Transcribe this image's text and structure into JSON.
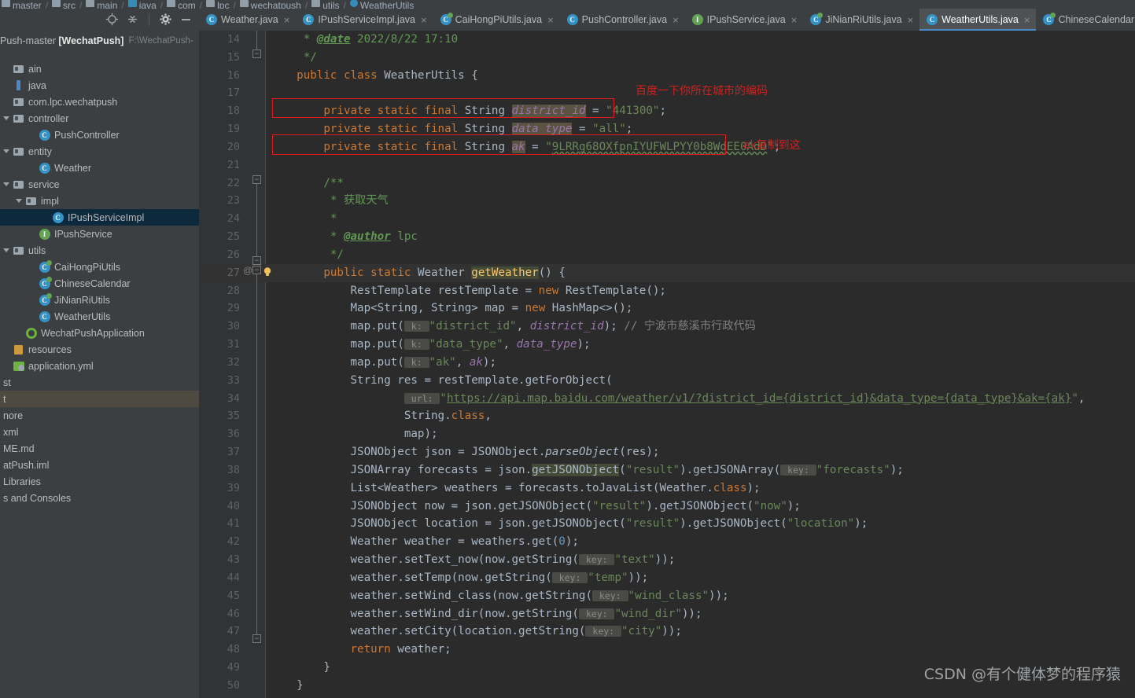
{
  "window": {
    "project_label_left": "Push-master",
    "project_name": "[WechatPush]",
    "project_path": "F:\\WechatPush-"
  },
  "breadcrumb": {
    "items": [
      "master",
      "src",
      "main",
      "java",
      "com",
      "lpc",
      "wechatpush",
      "utils",
      "WeatherUtils"
    ]
  },
  "sidebar": {
    "toolbar_icons": [
      "locate-icon",
      "collapse-all-icon",
      "gear-icon",
      "minimize-icon"
    ],
    "tree": [
      {
        "label": "ain",
        "icon": "folder-icon",
        "indent": 0,
        "arrow": "none",
        "selected": "none"
      },
      {
        "label": "java",
        "icon": "source-root-icon",
        "indent": 0,
        "arrow": "none",
        "selected": "none"
      },
      {
        "label": "com.lpc.wechatpush",
        "icon": "package-icon",
        "indent": 1,
        "arrow": "none",
        "selected": "none"
      },
      {
        "label": "controller",
        "icon": "package-icon",
        "indent": 1,
        "arrow": "open",
        "selected": "none"
      },
      {
        "label": "PushController",
        "icon": "class-icon",
        "indent": 3,
        "arrow": "none",
        "selected": "none"
      },
      {
        "label": "entity",
        "icon": "package-icon",
        "indent": 1,
        "arrow": "open",
        "selected": "none"
      },
      {
        "label": "Weather",
        "icon": "class-icon",
        "indent": 3,
        "arrow": "none",
        "selected": "none"
      },
      {
        "label": "service",
        "icon": "package-icon",
        "indent": 1,
        "arrow": "open",
        "selected": "none"
      },
      {
        "label": "impl",
        "icon": "package-icon",
        "indent": 2,
        "arrow": "open",
        "selected": "none"
      },
      {
        "label": "IPushServiceImpl",
        "icon": "class-icon",
        "indent": 4,
        "arrow": "none",
        "selected": "blue"
      },
      {
        "label": "IPushService",
        "icon": "interface-icon",
        "indent": 3,
        "arrow": "none",
        "selected": "none"
      },
      {
        "label": "utils",
        "icon": "package-icon",
        "indent": 1,
        "arrow": "open",
        "selected": "none"
      },
      {
        "label": "CaiHongPiUtils",
        "icon": "class-green-icon",
        "indent": 3,
        "arrow": "none",
        "selected": "none"
      },
      {
        "label": "ChineseCalendar",
        "icon": "class-green-icon",
        "indent": 3,
        "arrow": "none",
        "selected": "none"
      },
      {
        "label": "JiNianRiUtils",
        "icon": "class-green-icon",
        "indent": 3,
        "arrow": "none",
        "selected": "none"
      },
      {
        "label": "WeatherUtils",
        "icon": "class-icon",
        "indent": 3,
        "arrow": "none",
        "selected": "none"
      },
      {
        "label": "WechatPushApplication",
        "icon": "spring-boot-icon",
        "indent": 2,
        "arrow": "none",
        "selected": "none"
      },
      {
        "label": "resources",
        "icon": "resource-root-icon",
        "indent": 0,
        "arrow": "none",
        "selected": "none"
      },
      {
        "label": "application.yml",
        "icon": "yml-icon",
        "indent": 1,
        "arrow": "none",
        "selected": "none"
      },
      {
        "label": "st",
        "icon": "none",
        "indent": 0,
        "arrow": "none",
        "selected": "none"
      },
      {
        "label": "t",
        "icon": "none",
        "indent": 0,
        "arrow": "none",
        "selected": "grey"
      },
      {
        "label": "nore",
        "icon": "none",
        "indent": 0,
        "arrow": "none",
        "selected": "none"
      },
      {
        "label": "xml",
        "icon": "none",
        "indent": 0,
        "arrow": "none",
        "selected": "none"
      },
      {
        "label": "ME.md",
        "icon": "none",
        "indent": 0,
        "arrow": "none",
        "selected": "none"
      },
      {
        "label": "atPush.iml",
        "icon": "none",
        "indent": 0,
        "arrow": "none",
        "selected": "none"
      },
      {
        "label": "Libraries",
        "icon": "none",
        "indent": 0,
        "arrow": "none",
        "selected": "none"
      },
      {
        "label": "s and Consoles",
        "icon": "none",
        "indent": 0,
        "arrow": "none",
        "selected": "none"
      }
    ]
  },
  "tabs": [
    {
      "label": "Weather.java",
      "icon": "class-icon",
      "active": false,
      "closable": true
    },
    {
      "label": "IPushServiceImpl.java",
      "icon": "class-icon",
      "active": false,
      "closable": true
    },
    {
      "label": "CaiHongPiUtils.java",
      "icon": "class-green-icon",
      "active": false,
      "closable": true
    },
    {
      "label": "PushController.java",
      "icon": "class-icon",
      "active": false,
      "closable": true
    },
    {
      "label": "IPushService.java",
      "icon": "interface-icon",
      "active": false,
      "closable": true
    },
    {
      "label": "JiNianRiUtils.java",
      "icon": "class-green-icon",
      "active": false,
      "closable": true
    },
    {
      "label": "WeatherUtils.java",
      "icon": "class-icon",
      "active": true,
      "closable": true
    },
    {
      "label": "ChineseCalendar",
      "icon": "class-green-icon",
      "active": false,
      "closable": false
    }
  ],
  "editor": {
    "first_line_number": 14,
    "last_line_number": 50,
    "line_numbers": [
      14,
      15,
      16,
      17,
      18,
      19,
      20,
      21,
      22,
      23,
      24,
      25,
      26,
      27,
      28,
      29,
      30,
      31,
      32,
      33,
      34,
      35,
      36,
      37,
      38,
      39,
      40,
      41,
      42,
      43,
      44,
      45,
      46,
      47,
      48,
      49,
      50
    ],
    "code_lines": [
      "     * @date 2022/8/22 17:10",
      "     */",
      "    public class WeatherUtils {",
      "",
      "        private static final String district_id = \"441300\";",
      "        private static final String data_type = \"all\";",
      "        private static final String ak = \"9LRRg68OXfpnIYUFWLPYY0b8WdEE0AdD\";",
      "",
      "        /**",
      "         * 获取天气",
      "         *",
      "         * @author lpc",
      "         */",
      "        public static Weather getWeather() {",
      "            RestTemplate restTemplate = new RestTemplate();",
      "            Map<String, String> map = new HashMap<>();",
      "            map.put( k: \"district_id\", district_id); // 宁波市慈溪市行政代码",
      "            map.put( k: \"data_type\", data_type);",
      "            map.put( k: \"ak\", ak);",
      "            String res = restTemplate.getForObject(",
      "                    url: \"https://api.map.baidu.com/weather/v1/?district_id={district_id}&data_type={data_type}&ak={ak}\",",
      "                    String.class,",
      "                    map);",
      "            JSONObject json = JSONObject.parseObject(res);",
      "            JSONArray forecasts = json.getJSONObject(\"result\").getJSONArray( key: \"forecasts\");",
      "            List<Weather> weathers = forecasts.toJavaList(Weather.class);",
      "            JSONObject now = json.getJSONObject(\"result\").getJSONObject(\"now\");",
      "            JSONObject location = json.getJSONObject(\"result\").getJSONObject(\"location\");",
      "            Weather weather = weathers.get(0);",
      "            weather.setText_now(now.getString( key: \"text\"));",
      "            weather.setTemp(now.getString( key: \"temp\"));",
      "            weather.setWind_class(now.getString( key: \"wind_class\"));",
      "            weather.setWind_dir(now.getString( key: \"wind_dir\"));",
      "            weather.setCity(location.getString( key: \"city\"));",
      "            return weather;",
      "        }",
      "    }"
    ],
    "values": {
      "javadoc_date": "2022/8/22 17:10",
      "class_name": "WeatherUtils",
      "district_id": "441300",
      "data_type": "all",
      "ak": "9LRRg68OXfpnIYUFWLPYY0b8WdEE0AdD",
      "javadoc_summary": "获取天气",
      "javadoc_author": "lpc",
      "method_name": "getWeather",
      "url": "https://api.map.baidu.com/weather/v1/?district_id={district_id}&data_type={data_type}&ak={ak}",
      "inline_comment": "// 宁波市慈溪市行政代码",
      "param_hint_k": "k:",
      "param_hint_key": "key:",
      "param_hint_url": "url:"
    },
    "highlighted_line": 27,
    "gutter_marker": "@",
    "caret_line": 27
  },
  "annotations": [
    {
      "text": "百度一下你所在城市的编码",
      "color": "#cc2222",
      "target": "district_id-line"
    },
    {
      "text": "ak复制到这",
      "color": "#cc2222",
      "target": "ak-line"
    }
  ],
  "watermark": "CSDN @有个健体梦的程序猿",
  "colors": {
    "editor_bg": "#2b2b2b",
    "gutter_bg": "#313335",
    "panel_bg": "#3c3f41",
    "tab_active_bg": "#4e5254",
    "tab_underline": "#4a88c7",
    "keyword": "#cc7832",
    "string": "#6a8759",
    "number": "#6897bb",
    "comment": "#808080",
    "javadoc": "#629755",
    "field": "#9876aa",
    "method": "#ffc66d",
    "default_text": "#a9b7c6",
    "annotation_red": "#cc2222",
    "selection_blue": "#0d293e"
  }
}
